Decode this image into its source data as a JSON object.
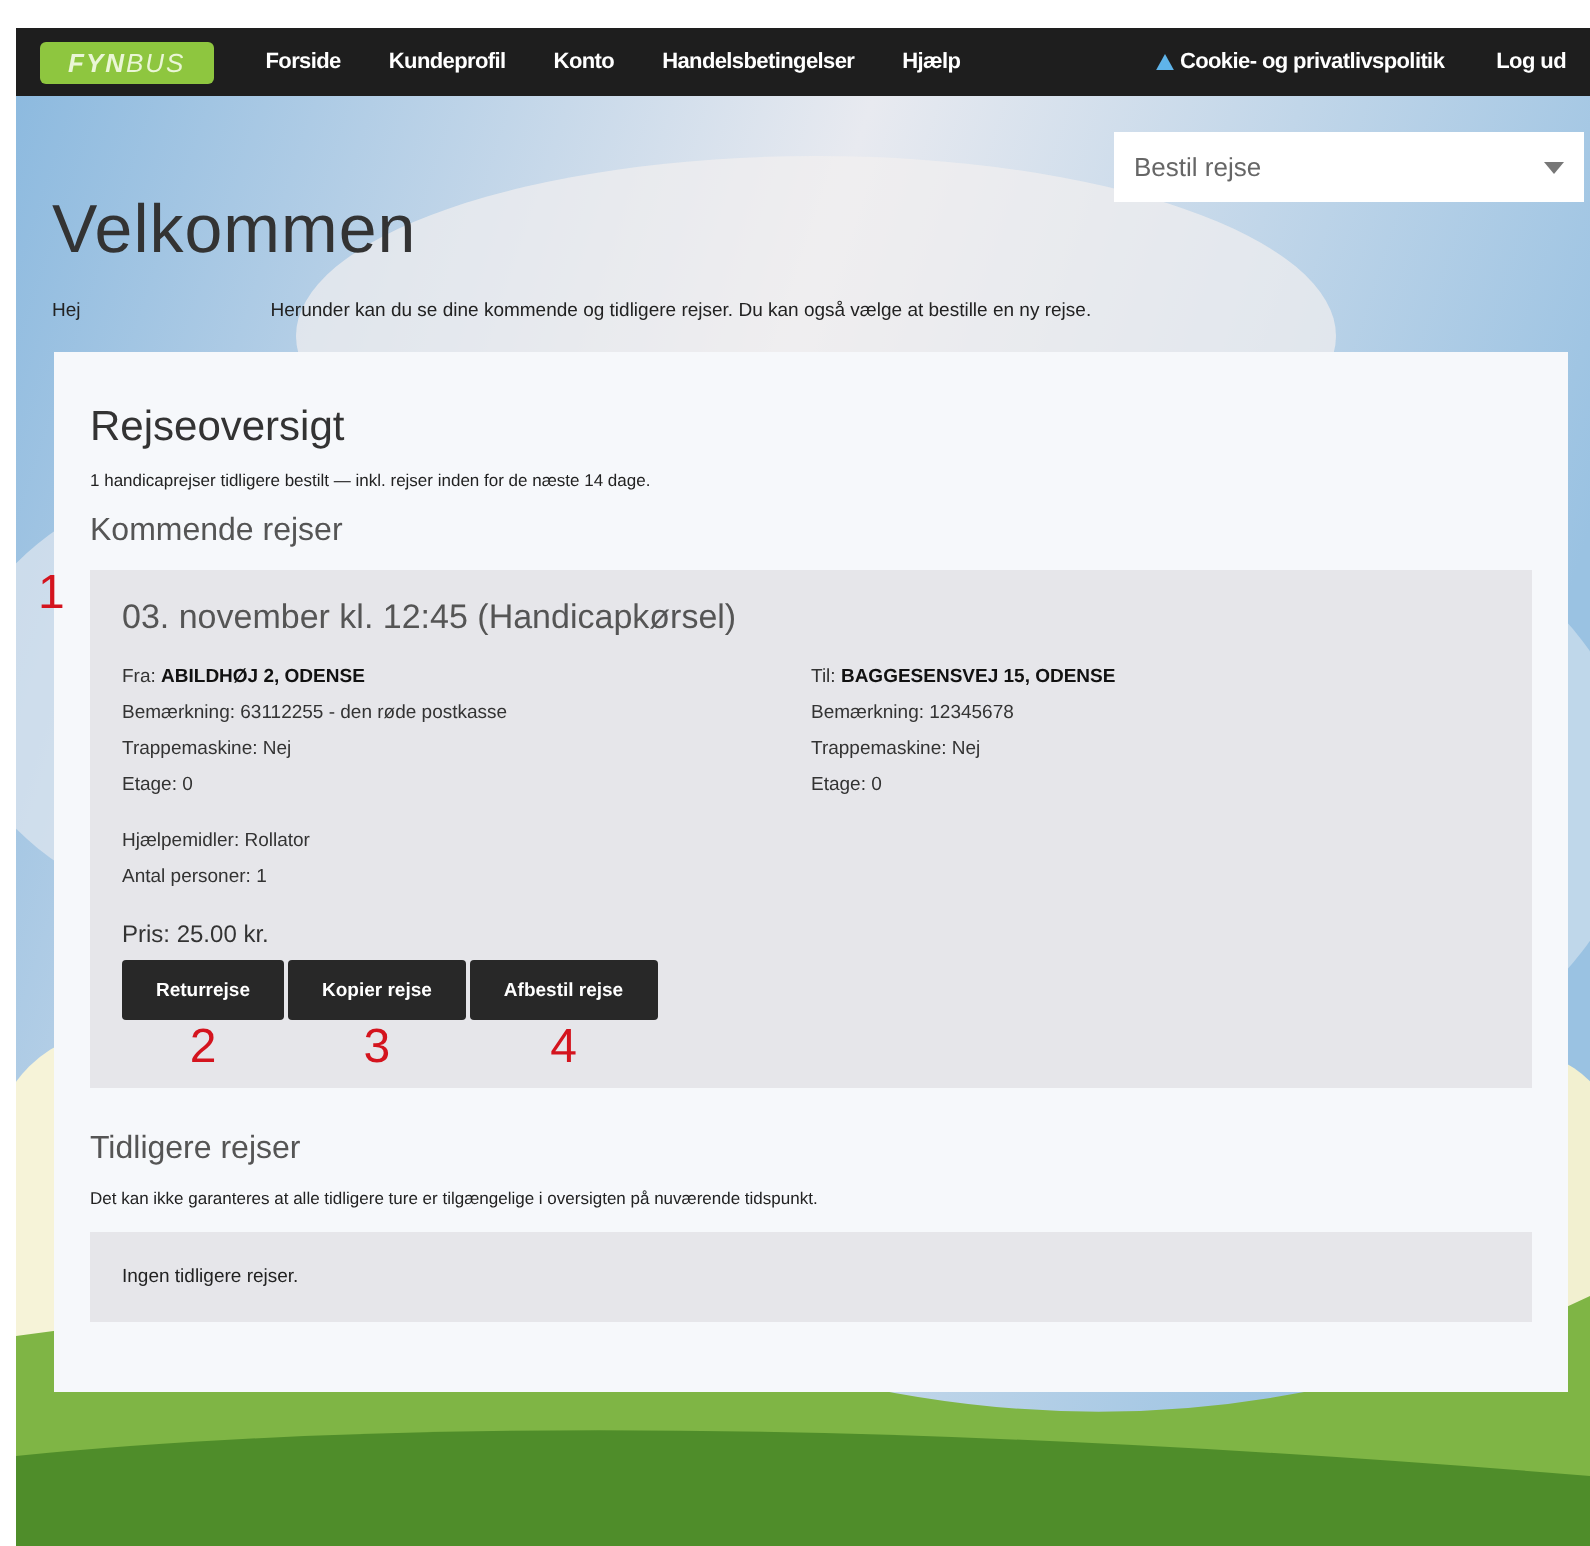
{
  "nav": {
    "logo": {
      "first": "FYN",
      "second": "BUS"
    },
    "items": [
      {
        "label": "Forside"
      },
      {
        "label": "Kundeprofil"
      },
      {
        "label": "Konto"
      },
      {
        "label": "Handelsbetingelser"
      },
      {
        "label": "Hjælp"
      }
    ],
    "cookie": "Cookie- og privatlivspolitik",
    "logout": "Log ud"
  },
  "header": {
    "title": "Velkommen",
    "greeting": "Hej",
    "intro": "Herunder kan du se dine kommende og tidligere rejser. Du kan også vælge at bestille en ny rejse.",
    "dropdown": {
      "value": "Bestil rejse"
    }
  },
  "overview": {
    "title": "Rejseoversigt",
    "summary": "1 handicaprejser tidligere bestilt — inkl. rejser inden for de næste 14 dage.",
    "upcoming": {
      "title": "Kommende rejser",
      "trips": [
        {
          "marker": "1",
          "title": "03. november kl. 12:45 (Handicapkørsel)",
          "from": {
            "label": "Fra:",
            "address": "ABILDHØJ 2, ODENSE",
            "lines": [
              "Bemærkning: 63112255 - den røde postkasse",
              "Trappemaskine: Nej",
              "Etage: 0"
            ]
          },
          "to": {
            "label": "Til:",
            "address": "BAGGESENSVEJ 15, ODENSE",
            "lines": [
              "Bemærkning: 12345678",
              "Trappemaskine: Nej",
              "Etage: 0"
            ]
          },
          "extras": [
            "Hjælpemidler: Rollator",
            "Antal personer: 1"
          ],
          "price": "Pris: 25.00 kr.",
          "buttons": [
            {
              "label": "Returrejse",
              "marker": "2"
            },
            {
              "label": "Kopier rejse",
              "marker": "3"
            },
            {
              "label": "Afbestil rejse",
              "marker": "4"
            }
          ]
        }
      ]
    },
    "previous": {
      "title": "Tidligere rejser",
      "note": "Det kan ikke garanteres at alle tidligere ture er tilgængelige i oversigten på nuværende tidspunkt.",
      "empty": "Ingen tidligere rejser."
    }
  }
}
